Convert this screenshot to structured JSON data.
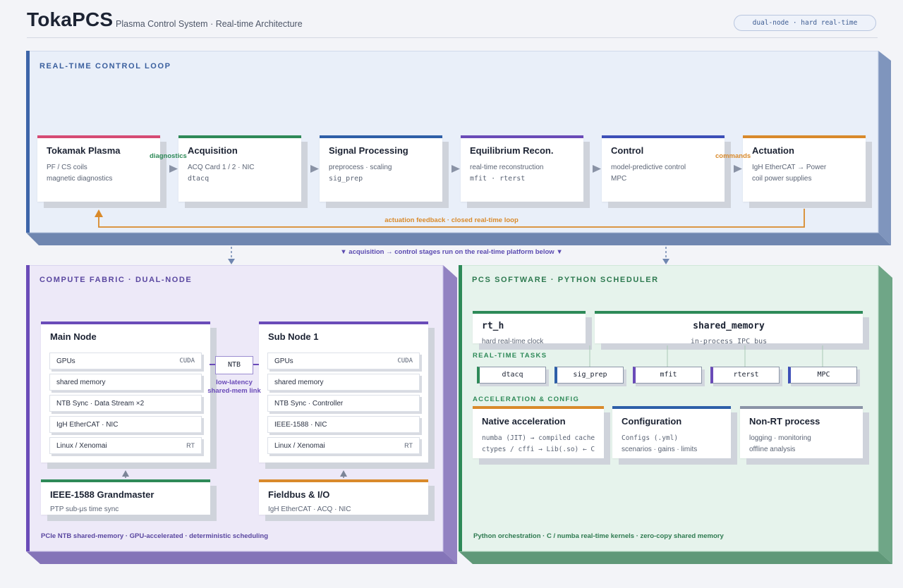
{
  "header": {
    "title": "TokaPCS",
    "subtitle": "Plasma Control System · Real-time Architecture",
    "pill": "dual-node · hard real-time"
  },
  "control_loop": {
    "title": "REAL-TIME CONTROL LOOP",
    "stages": [
      {
        "title": "Tokamak Plasma",
        "line1": "PF / CS coils",
        "line2": "magnetic diagnostics",
        "color": "#d64b74"
      },
      {
        "title": "Acquisition",
        "line1": "ACQ Card 1 / 2 · NIC",
        "line2": "dtacq",
        "color": "#2e8a58"
      },
      {
        "title": "Signal Processing",
        "line1": "preprocess · scaling",
        "line2": "sig_prep",
        "color": "#2e5fa8"
      },
      {
        "title": "Equilibrium Recon.",
        "line1": "real-time reconstruction",
        "line2": "mfit · rterst",
        "color": "#6a4bb8"
      },
      {
        "title": "Control",
        "line1": "model-predictive control",
        "line2": "MPC",
        "color": "#3d4fb8"
      },
      {
        "title": "Actuation",
        "line1": "IgH EtherCAT → Power",
        "line2": "coil power supplies",
        "color": "#d98a2b"
      }
    ],
    "label_diagnostics": "diagnostics",
    "label_commands": "commands",
    "feedback_label": "actuation feedback · closed real-time loop",
    "bridge_label": "▼ acquisition → control stages run on the real-time platform below ▼"
  },
  "compute": {
    "title": "COMPUTE FABRIC · DUAL-NODE",
    "main_node": {
      "title": "Main Node",
      "rows": [
        {
          "label": "GPUs",
          "tag": "CUDA"
        },
        {
          "label": "shared memory",
          "tag": ""
        },
        {
          "label": "NTB Sync · Data Stream ×2",
          "tag": ""
        },
        {
          "label": "IgH EtherCAT · NIC",
          "tag": ""
        },
        {
          "label": "Linux / Xenomai",
          "tag": "RT"
        }
      ]
    },
    "sub_node": {
      "title": "Sub Node 1",
      "rows": [
        {
          "label": "GPUs",
          "tag": "CUDA"
        },
        {
          "label": "shared memory",
          "tag": ""
        },
        {
          "label": "NTB Sync · Controller",
          "tag": ""
        },
        {
          "label": "IEEE-1588 · NIC",
          "tag": ""
        },
        {
          "label": "Linux / Xenomai",
          "tag": "RT"
        }
      ]
    },
    "ntb": {
      "label": "NTB",
      "caption1": "low-latency",
      "caption2": "shared-mem link"
    },
    "grandmaster": {
      "title": "IEEE-1588 Grandmaster",
      "line1": "PTP sub-μs time sync"
    },
    "fieldbus": {
      "title": "Fieldbus & I/O",
      "line1": "IgH EtherCAT · ACQ · NIC"
    },
    "footnote": "PCIe NTB shared-memory · GPU-accelerated · deterministic scheduling"
  },
  "software": {
    "title": "PCS SOFTWARE · PYTHON SCHEDULER",
    "rt_h": {
      "title": "rt_h",
      "line1": "hard real-time clock"
    },
    "shared_memory": {
      "title": "shared_memory",
      "line1": "in-process IPC bus"
    },
    "rt_tasks_label": "REAL-TIME TASKS",
    "tasks": [
      {
        "label": "dtacq",
        "color": "#2e8a58"
      },
      {
        "label": "sig_prep",
        "color": "#2e5fa8"
      },
      {
        "label": "mfit",
        "color": "#6a4bb8"
      },
      {
        "label": "rterst",
        "color": "#6a4bb8"
      },
      {
        "label": "MPC",
        "color": "#3d4fb8"
      }
    ],
    "accel_label": "ACCELERATION & CONFIG",
    "native": {
      "title": "Native acceleration",
      "line1": "numba (JIT) → compiled cache",
      "line2": "ctypes / cffi → Lib(.so) ← C"
    },
    "config": {
      "title": "Configuration",
      "line1": "Configs (.yml)",
      "line2": "scenarios · gains · limits"
    },
    "nonrt": {
      "title": "Non-RT process",
      "line1": "logging · monitoring",
      "line2": "offline analysis"
    },
    "footnote": "Python orchestration · C / numba real-time kernels · zero-copy shared memory"
  },
  "colors": {
    "loop_panel": "#e9eff9",
    "compute_panel": "#ede9f8",
    "software_panel": "#e6f3ec",
    "feedback": "#d98a2b"
  }
}
